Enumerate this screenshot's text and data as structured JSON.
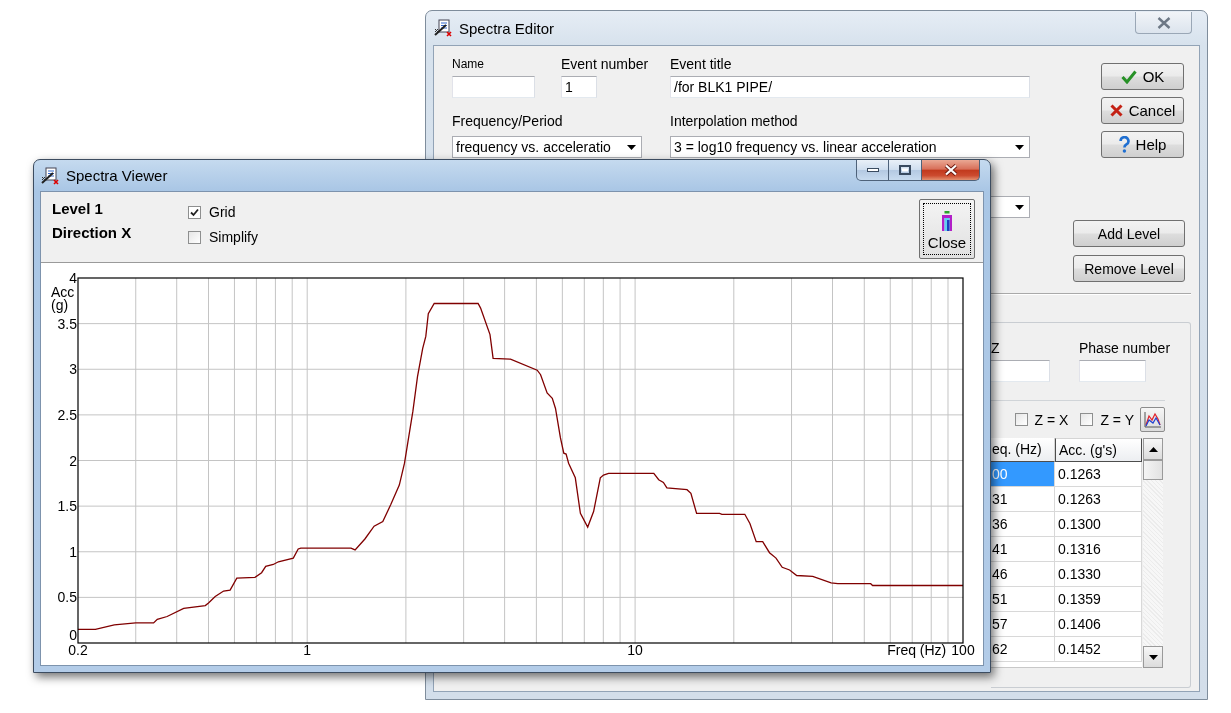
{
  "editor": {
    "title": "Spectra Editor",
    "name_field": {
      "label": "Name"
    },
    "event_number": {
      "label": "Event number",
      "value": "1"
    },
    "event_title": {
      "label": "Event title",
      "value": "/for BLK1 PIPE/"
    },
    "frequency_period": {
      "label": "Frequency/Period",
      "value": "frequency vs. acceleratio"
    },
    "interpolation_method": {
      "label": "Interpolation method",
      "value": "3 = log10 frequency vs. linear acceleration"
    },
    "buttons": [
      {
        "label": "OK",
        "kind": "ok"
      },
      {
        "label": "Cancel",
        "kind": "cancel"
      },
      {
        "label": "Help",
        "kind": "help"
      }
    ],
    "level_buttons": [
      "Add Level",
      "Remove Level"
    ],
    "z_field": {
      "label": "Z"
    },
    "phase_number": {
      "label": "Phase number"
    },
    "checkboxes": [
      {
        "label": "Z = X",
        "checked": false
      },
      {
        "label": "Z = Y",
        "checked": false
      }
    ],
    "table": {
      "columns": [
        "eq. (Hz)",
        "Acc. (g's)"
      ],
      "rows": [
        {
          "cells": [
            "00",
            "0.1263"
          ],
          "selected": true
        },
        {
          "cells": [
            "31",
            "0.1263"
          ],
          "selected": false
        },
        {
          "cells": [
            "36",
            "0.1300"
          ],
          "selected": false
        },
        {
          "cells": [
            "41",
            "0.1316"
          ],
          "selected": false
        },
        {
          "cells": [
            "46",
            "0.1330"
          ],
          "selected": false
        },
        {
          "cells": [
            "51",
            "0.1359"
          ],
          "selected": false
        },
        {
          "cells": [
            "57",
            "0.1406"
          ],
          "selected": false
        },
        {
          "cells": [
            "62",
            "0.1452"
          ],
          "selected": false
        }
      ]
    }
  },
  "viewer": {
    "title": "Spectra Viewer",
    "level": "Level 1",
    "direction": "Direction X",
    "options": [
      {
        "label": "Grid",
        "checked": true
      },
      {
        "label": "Simplify",
        "checked": false
      }
    ],
    "close_button": "Close",
    "chart_data": {
      "type": "line",
      "xlabel": "Freq (Hz)",
      "ylabel": "Acc (g)",
      "log": "x",
      "grid": true,
      "x": [
        0.2,
        0.226,
        0.258,
        0.3,
        0.34,
        0.349,
        0.374,
        0.42,
        0.489,
        0.5,
        0.524,
        0.556,
        0.582,
        0.61,
        0.693,
        0.726,
        0.747,
        0.788,
        0.817,
        0.907,
        0.939,
        0.956,
        1.36,
        1.4,
        1.5,
        1.6,
        1.7,
        1.8,
        1.91,
        1.98,
        2.03,
        2.1,
        2.17,
        2.25,
        2.3,
        2.34,
        2.44,
        3.32,
        3.38,
        3.61,
        3.69,
        4.17,
        5.03,
        5.15,
        5.39,
        5.59,
        5.72,
        5.92,
        6.06,
        6.16,
        6.27,
        6.57,
        6.81,
        7.17,
        7.47,
        7.83,
        8.01,
        8.3,
        11.4,
        11.8,
        12.2,
        12.5,
        14.4,
        14.8,
        15.4,
        18.1,
        18.4,
        21.6,
        22.4,
        23.4,
        24.5,
        25.7,
        26.9,
        28.1,
        29.6,
        31.1,
        34.8,
        39.6,
        41.5,
        52.3,
        53,
        100
      ],
      "series": [
        {
          "color": "#800000",
          "values": [
            0.15,
            0.15,
            0.2,
            0.22,
            0.22,
            0.26,
            0.29,
            0.38,
            0.41,
            0.44,
            0.51,
            0.57,
            0.58,
            0.71,
            0.72,
            0.77,
            0.84,
            0.86,
            0.89,
            0.93,
            1.03,
            1.04,
            1.04,
            1.02,
            1.14,
            1.28,
            1.33,
            1.52,
            1.73,
            1.97,
            2.21,
            2.54,
            2.92,
            3.23,
            3.36,
            3.61,
            3.72,
            3.72,
            3.67,
            3.38,
            3.12,
            3.11,
            2.99,
            2.94,
            2.74,
            2.68,
            2.57,
            2.25,
            2.08,
            2.07,
            1.97,
            1.81,
            1.42,
            1.27,
            1.44,
            1.81,
            1.84,
            1.86,
            1.86,
            1.79,
            1.76,
            1.7,
            1.68,
            1.64,
            1.42,
            1.42,
            1.41,
            1.41,
            1.31,
            1.11,
            1.11,
            0.99,
            0.93,
            0.83,
            0.8,
            0.74,
            0.73,
            0.66,
            0.65,
            0.65,
            0.63,
            0.63
          ]
        }
      ],
      "xlim": [
        0.2,
        100
      ],
      "ylim": [
        0,
        4
      ],
      "xticks": [
        0.2,
        1,
        10,
        100
      ],
      "yticks": [
        0,
        0.5,
        1,
        1.5,
        2,
        2.5,
        3,
        3.5,
        4
      ]
    }
  }
}
